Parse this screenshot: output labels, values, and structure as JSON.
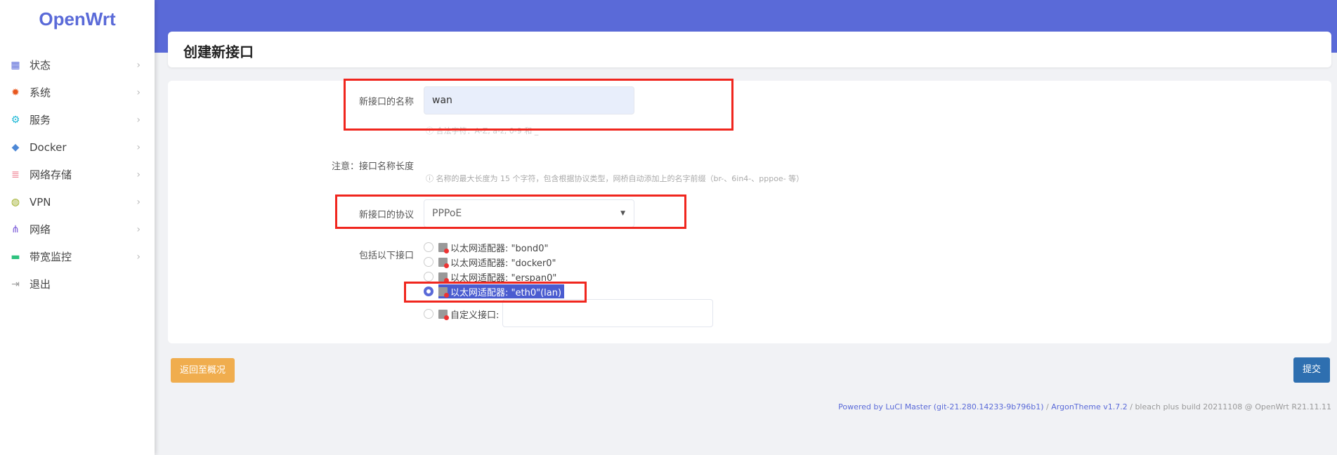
{
  "logo": "OpenWrt",
  "sidebar": {
    "items": [
      {
        "label": "状态",
        "icon": "dashboard-icon",
        "color": "#5a6ad8"
      },
      {
        "label": "系统",
        "icon": "gear-icon",
        "color": "#e8571e"
      },
      {
        "label": "服务",
        "icon": "gears-icon",
        "color": "#1fb8d6"
      },
      {
        "label": "Docker",
        "icon": "docker-icon",
        "color": "#4d88d6"
      },
      {
        "label": "网络存储",
        "icon": "database-icon",
        "color": "#f08a9a"
      },
      {
        "label": "VPN",
        "icon": "globe-icon",
        "color": "#9aaa1e"
      },
      {
        "label": "网络",
        "icon": "sitemap-icon",
        "color": "#7a5ad8"
      },
      {
        "label": "带宽监控",
        "icon": "monitor-icon",
        "color": "#2ec27e"
      },
      {
        "label": "退出",
        "icon": "logout-icon",
        "color": "#999999"
      }
    ]
  },
  "page_title": "创建新接口",
  "form": {
    "name_label": "新接口的名称",
    "name_value": "wan",
    "name_hint": "合法字符：A-Z, a-z, 0-9 和 _",
    "note_label": "注意：接口名称长度",
    "note_hint": "名称的最大长度为 15 个字符，包含根据协议类型，网桥自动添加上的名字前缀（br-、6in4-、pppoe- 等）",
    "proto_label": "新接口的协议",
    "proto_value": "PPPoE",
    "include_label": "包括以下接口",
    "interfaces": [
      {
        "label": "以太网适配器: \"bond0\"",
        "selected": false
      },
      {
        "label": "以太网适配器: \"docker0\"",
        "selected": false
      },
      {
        "label": "以太网适配器: \"erspan0\"",
        "selected": false
      },
      {
        "label": "以太网适配器: \"eth0\"(lan)",
        "selected": true
      }
    ],
    "custom_label": "自定义接口:",
    "custom_value": ""
  },
  "buttons": {
    "back": "返回至概况",
    "submit": "提交"
  },
  "footer": {
    "luci": "Powered by LuCI Master (git-21.280.14233-9b796b1)",
    "sep1": " / ",
    "theme": "ArgonTheme v1.7.2",
    "rest": " / bleach plus build 20211108 @ OpenWrt R21.11.11"
  },
  "colors": {
    "accent": "#5a6ad8",
    "back": "#f0ad4e",
    "submit": "#2e6fb0",
    "highlight": "#f0261e"
  }
}
